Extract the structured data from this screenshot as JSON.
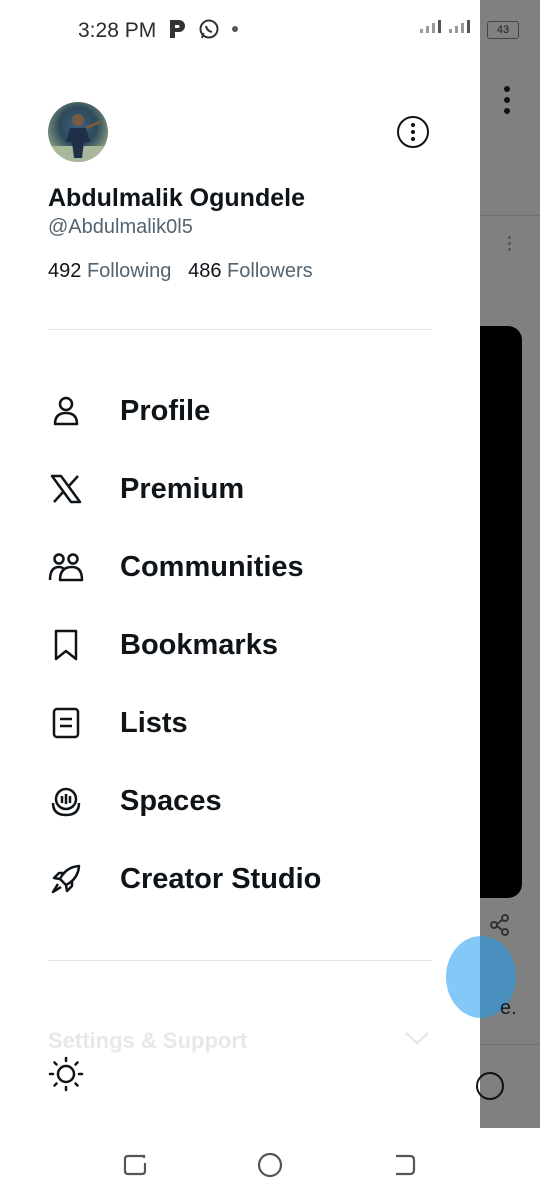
{
  "status_bar": {
    "time": "3:28 PM",
    "icons": [
      "p-app-icon",
      "whatsapp-icon",
      "notification-dot"
    ],
    "battery": "43"
  },
  "drawer": {
    "more_icon": "more-circle-icon",
    "user": {
      "name": "Abdulmalik Ogundele",
      "handle": "@Abdulmalik0l5",
      "following_count": "492",
      "following_label": "Following",
      "followers_count": "486",
      "followers_label": "Followers"
    },
    "menu": [
      {
        "label": "Profile",
        "icon": "person-icon"
      },
      {
        "label": "Premium",
        "icon": "x-logo-icon"
      },
      {
        "label": "Communities",
        "icon": "communities-icon"
      },
      {
        "label": "Bookmarks",
        "icon": "bookmark-icon"
      },
      {
        "label": "Lists",
        "icon": "list-icon"
      },
      {
        "label": "Spaces",
        "icon": "spaces-icon"
      },
      {
        "label": "Creator Studio",
        "icon": "rocket-icon"
      }
    ],
    "settings_label": "Settings & Support",
    "theme_icon": "sun-icon"
  },
  "background": {
    "partial_text": "e."
  },
  "colors": {
    "primary_text": "#0f1419",
    "secondary_text": "#536471",
    "divider": "#e1e4e8",
    "accent": "#1d9bf0"
  }
}
